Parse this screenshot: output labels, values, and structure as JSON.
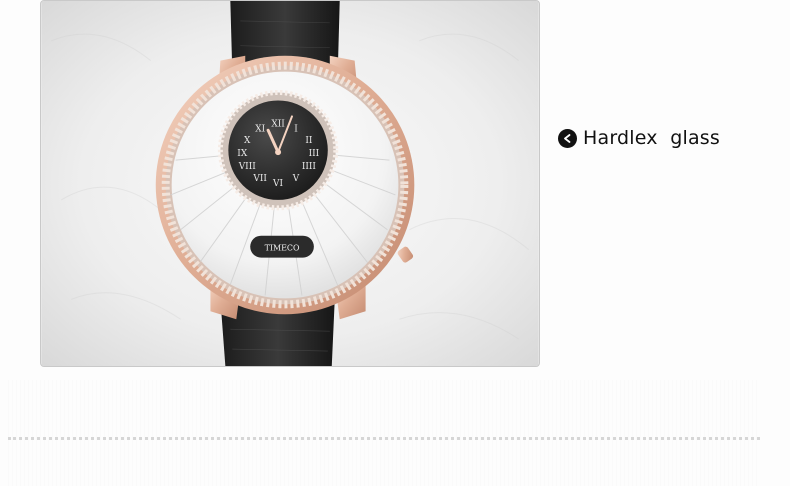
{
  "product_image": {
    "dial_numerals": [
      "XII",
      "I",
      "II",
      "III",
      "IIII",
      "V",
      "VI",
      "VII",
      "VIII",
      "IX",
      "X",
      "XI"
    ]
  },
  "feature": {
    "icon": "left-arrow-icon",
    "label": "Hardlex  glass"
  },
  "colors": {
    "icon_bg": "#111111",
    "text": "#111111",
    "rose_gold": "#e3b8a0",
    "divider": "#d6d6d6"
  }
}
